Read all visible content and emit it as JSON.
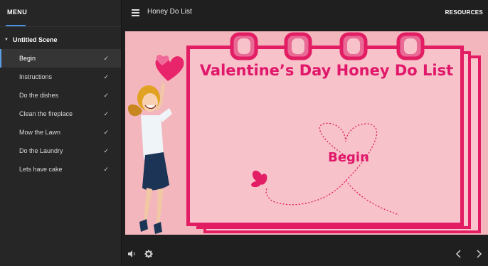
{
  "sidebar": {
    "menu_label": "MENU",
    "scene_label": "Untitled Scene",
    "items": [
      {
        "label": "Begin",
        "done": true
      },
      {
        "label": "Instructions",
        "done": true
      },
      {
        "label": "Do the dishes",
        "done": true
      },
      {
        "label": "Clean the fireplace",
        "done": true
      },
      {
        "label": "Mow the Lawn",
        "done": true
      },
      {
        "label": "Do the Laundry",
        "done": true
      },
      {
        "label": "Lets have cake",
        "done": true
      }
    ],
    "check_glyph": "✓"
  },
  "topbar": {
    "title": "Honey Do List",
    "resources_label": "RESOURCES"
  },
  "stage": {
    "headline": "Valentine’s Day Honey Do List",
    "begin_label": "Begin"
  },
  "colors": {
    "accent": "#4a90e2",
    "stage_bg": "#f3b6bd",
    "card_bg": "#f8c6cc",
    "card_border": "#e21d63",
    "heading": "#e0176a"
  },
  "icons": {
    "menu": "hamburger-icon",
    "audio": "speaker-icon",
    "settings": "gear-icon",
    "prev": "chevron-left-icon",
    "next": "chevron-right-icon"
  }
}
